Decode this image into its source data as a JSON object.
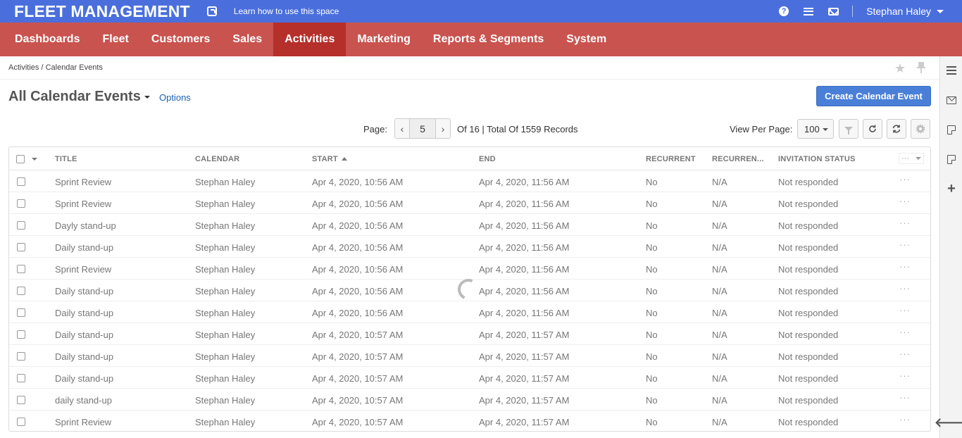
{
  "topbar": {
    "brand": "FLEET MANAGEMENT",
    "learn_link": "Learn how to use this space",
    "user_name": "Stephan Haley",
    "help_glyph": "?",
    "color": "#4a6fdc"
  },
  "nav": {
    "items": [
      {
        "label": "Dashboards"
      },
      {
        "label": "Fleet"
      },
      {
        "label": "Customers"
      },
      {
        "label": "Sales"
      },
      {
        "label": "Activities",
        "active": true
      },
      {
        "label": "Marketing"
      },
      {
        "label": "Reports & Segments"
      },
      {
        "label": "System"
      }
    ],
    "color": "#c9534f",
    "active_color": "#b52f2b"
  },
  "breadcrumb": "Activities / Calendar Events",
  "page": {
    "title": "All Calendar Events",
    "options_label": "Options",
    "create_label": "Create Calendar Event"
  },
  "pagination": {
    "page_label": "Page:",
    "current_page": "5",
    "prev_glyph": "‹",
    "next_glyph": "›",
    "summary": "Of 16 | Total Of 1559 Records",
    "view_per_page_label": "View Per Page:",
    "per_page": "100"
  },
  "toolbar_icons": [
    "filter-icon",
    "refresh-icon",
    "reset-icon",
    "settings-icon"
  ],
  "grid": {
    "columns": [
      "Title",
      "Calendar",
      "Start",
      "End",
      "Recurrent",
      "Recurren...",
      "Invitation Status"
    ],
    "actions_glyph": "···",
    "rows": [
      [
        "Sprint Review",
        "Stephan Haley",
        "Apr 4, 2020, 10:56 AM",
        "Apr 4, 2020, 11:56 AM",
        "No",
        "N/A",
        "Not responded"
      ],
      [
        "Sprint Review",
        "Stephan Haley",
        "Apr 4, 2020, 10:56 AM",
        "Apr 4, 2020, 11:56 AM",
        "No",
        "N/A",
        "Not responded"
      ],
      [
        "Dayly stand-up",
        "Stephan Haley",
        "Apr 4, 2020, 10:56 AM",
        "Apr 4, 2020, 11:56 AM",
        "No",
        "N/A",
        "Not responded"
      ],
      [
        "Daily stand-up",
        "Stephan Haley",
        "Apr 4, 2020, 10:56 AM",
        "Apr 4, 2020, 11:56 AM",
        "No",
        "N/A",
        "Not responded"
      ],
      [
        "Sprint Review",
        "Stephan Haley",
        "Apr 4, 2020, 10:56 AM",
        "Apr 4, 2020, 11:56 AM",
        "No",
        "N/A",
        "Not responded"
      ],
      [
        "Daily stand-up",
        "Stephan Haley",
        "Apr 4, 2020, 10:56 AM",
        "Apr 4, 2020, 11:56 AM",
        "No",
        "N/A",
        "Not responded"
      ],
      [
        "Daily stand-up",
        "Stephan Haley",
        "Apr 4, 2020, 10:56 AM",
        "Apr 4, 2020, 11:56 AM",
        "No",
        "N/A",
        "Not responded"
      ],
      [
        "Daily stand-up",
        "Stephan Haley",
        "Apr 4, 2020, 10:57 AM",
        "Apr 4, 2020, 11:57 AM",
        "No",
        "N/A",
        "Not responded"
      ],
      [
        "Daily stand-up",
        "Stephan Haley",
        "Apr 4, 2020, 10:57 AM",
        "Apr 4, 2020, 11:57 AM",
        "No",
        "N/A",
        "Not responded"
      ],
      [
        "Daily stand-up",
        "Stephan Haley",
        "Apr 4, 2020, 10:57 AM",
        "Apr 4, 2020, 11:57 AM",
        "No",
        "N/A",
        "Not responded"
      ],
      [
        "daily stand-up",
        "Stephan Haley",
        "Apr 4, 2020, 10:57 AM",
        "Apr 4, 2020, 11:57 AM",
        "No",
        "N/A",
        "Not responded"
      ],
      [
        "Sprint Review",
        "Stephan Haley",
        "Apr 4, 2020, 10:57 AM",
        "Apr 4, 2020, 11:57 AM",
        "No",
        "N/A",
        "Not responded"
      ]
    ]
  },
  "rail_icons": [
    "list-icon",
    "mail-icon",
    "note-icon",
    "note-icon",
    "plus-icon",
    "arrow-left-icon"
  ],
  "rail_glyphs": {
    "plus": "+",
    "arrow": "🡐"
  },
  "star_glyph": "★"
}
